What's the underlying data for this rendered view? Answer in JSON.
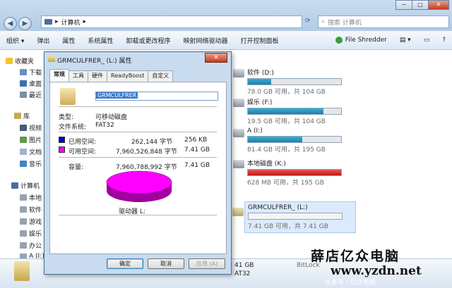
{
  "address": {
    "path": "计算机"
  },
  "search": {
    "placeholder": "搜索 计算机"
  },
  "toolbar": [
    "组织 ▾",
    "弹出",
    "属性",
    "系统属性",
    "卸载或更改程序",
    "映射网络驱动器",
    "打开控制面板"
  ],
  "toolbar_right": "File Shredder",
  "nav": {
    "favorites": "收藏夹",
    "downloads": "下载",
    "desktop": "桌面",
    "recent": "最近",
    "libraries": "库",
    "videos": "视频",
    "pictures": "图片",
    "documents": "文档",
    "music": "音乐",
    "computer": "计算机",
    "local": "本地",
    "software": "软件",
    "games": "游戏",
    "entertainment": "娱乐",
    "office": "办公",
    "a": "A (I:)"
  },
  "drives": [
    {
      "name": "软件 (D:)",
      "sub": "78.0 GB 可用，共 104 GB",
      "used": 0.25,
      "color": "#2a9ac4"
    },
    {
      "name": "娱乐 (F:)",
      "sub": "19.5 GB 可用，共 104 GB",
      "used": 0.81,
      "color": "#2a9ac4"
    },
    {
      "name": "A (I:)",
      "sub": "81.4 GB 可用，共 195 GB",
      "used": 0.58,
      "color": "#2a9ac4"
    },
    {
      "name": "本地磁盘 (K:)",
      "sub": "628 MB 可用，共 195 GB",
      "used": 0.997,
      "color": "#d32020"
    },
    {
      "name": "GRMCULFRER_ (L:)",
      "sub": "7.41 GB 可用，共 7.41 GB",
      "used": 0.0,
      "color": "#2a9ac4"
    }
  ],
  "status": {
    "size_partial": "41 GB",
    "fs_partial": "AT32",
    "bitlocker": "BitLock"
  },
  "dialog": {
    "title": "GRMCULFRER_ (L:) 属性",
    "close": "✕",
    "tabs": [
      "常规",
      "工具",
      "硬件",
      "ReadyBoost",
      "自定义"
    ],
    "name_value": "GRMCULFRER",
    "type_label": "类型:",
    "type_value": "可移动磁盘",
    "fs_label": "文件系统:",
    "fs_value": "FAT32",
    "used_label": "已用空间:",
    "used_bytes": "262,144 字节",
    "used_size": "256 KB",
    "free_label": "可用空间:",
    "free_bytes": "7,960,526,848 字节",
    "free_size": "7.41 GB",
    "cap_label": "容量:",
    "cap_bytes": "7,960,788,992 字节",
    "cap_size": "7.41 GB",
    "drive_label": "驱动器 L:",
    "ok": "确定",
    "cancel": "取消",
    "apply": "应用 (A)",
    "used_color": "#0000cc",
    "free_color": "#ff00ff"
  },
  "watermark": {
    "line1": "薛店亿众电脑",
    "line2": "www.yzdn.net",
    "line3": "头条号 / 亿众电脑"
  }
}
